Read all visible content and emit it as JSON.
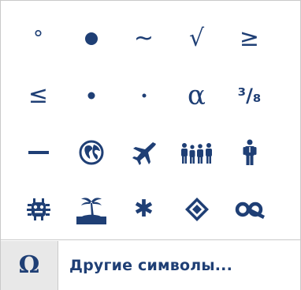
{
  "symbols": {
    "degree": "°",
    "bullet_large": "●",
    "tilde": "~",
    "sqrt": "√",
    "greater_equal": "≥",
    "less_equal": "≤",
    "bullet_medium": "•",
    "dot_small": "·",
    "alpha": "α",
    "fraction": "³/₈",
    "dash": "—",
    "snowflake": "✱",
    "diamond": "◈"
  },
  "footer": {
    "omega_symbol": "Ω",
    "more_label": "Другие символы..."
  },
  "colors": {
    "accent": "#1f3f75",
    "omega_bg": "#e8e8e8"
  }
}
